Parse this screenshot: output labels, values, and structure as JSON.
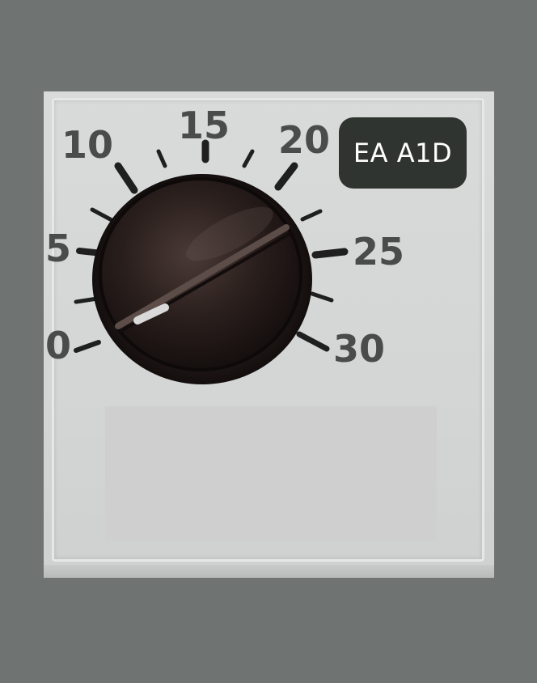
{
  "image": {
    "subject": "rotary-timer-dial",
    "knob_color": "#241b19",
    "panel_color": "#d6d8d8",
    "background_color": "#6f7371",
    "scale_numbers": [
      "0",
      "5",
      "10",
      "15",
      "20",
      "25",
      "30"
    ]
  },
  "badge": {
    "text": "EA A1D",
    "color": "#2f3430"
  }
}
